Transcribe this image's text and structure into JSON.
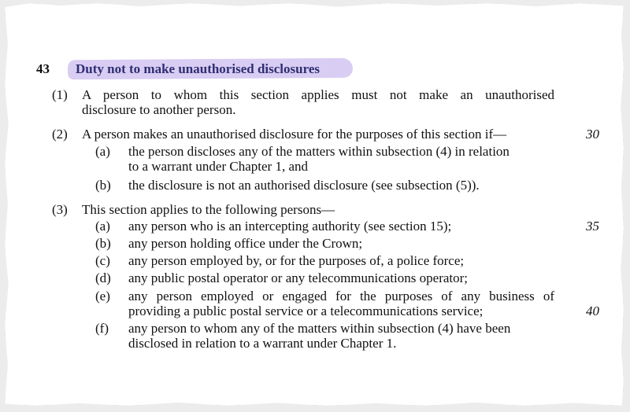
{
  "section": {
    "number": "43",
    "title": "Duty not to make unauthorised disclosures"
  },
  "sub1": {
    "label": "(1)",
    "line1": "A person to whom this section applies must not make an unauthorised",
    "line2": "disclosure to another person."
  },
  "sub2": {
    "label": "(2)",
    "text": "A person makes an unauthorised disclosure for the purposes of this section if—",
    "items": [
      {
        "label": "(a)",
        "line1": "the person discloses any of the matters within subsection (4) in relation",
        "line2": "to a warrant under Chapter 1, and"
      },
      {
        "label": "(b)",
        "line1": "the disclosure is not an authorised disclosure (see subsection (5))."
      }
    ]
  },
  "sub3": {
    "label": "(3)",
    "text": "This section applies to the following persons—",
    "items": [
      {
        "label": "(a)",
        "line1": "any person who is an intercepting authority (see section 15);"
      },
      {
        "label": "(b)",
        "line1": "any person holding office under the Crown;"
      },
      {
        "label": "(c)",
        "line1": "any person employed by, or for the purposes of, a police force;"
      },
      {
        "label": "(d)",
        "line1": "any public postal operator or any telecommunications operator;"
      },
      {
        "label": "(e)",
        "line1": "any person employed or engaged for the purposes of any business of",
        "line2": "providing a public postal service or a telecommunications service;"
      },
      {
        "label": "(f)",
        "line1": "any person to whom any of the matters within subsection (4) have been",
        "line2": "disclosed in relation to a warrant under Chapter 1."
      }
    ]
  },
  "line_numbers": [
    "30",
    "35",
    "40"
  ]
}
